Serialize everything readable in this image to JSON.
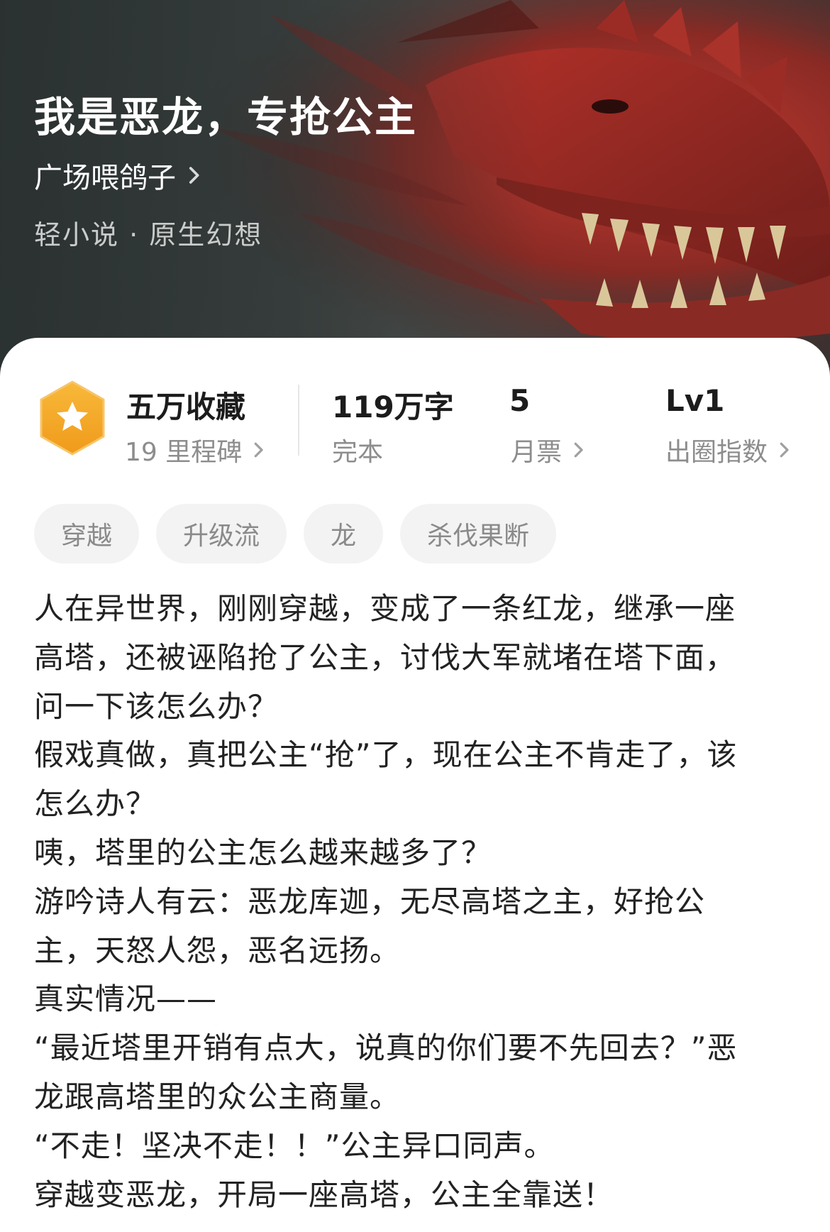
{
  "book": {
    "title": "我是恶龙，专抢公主",
    "author": "广场喂鸽子",
    "genre": "轻小说 · 原生幻想"
  },
  "stats": {
    "favorites": "五万收藏",
    "milestones": "19 里程碑",
    "word_count": "119万字",
    "status": "完本",
    "monthly_votes": "5",
    "monthly_votes_label": "月票",
    "level": "Lv1",
    "level_label": "出圈指数"
  },
  "tags": [
    "穿越",
    "升级流",
    "龙",
    "杀伐果断"
  ],
  "synopsis": [
    "人在异世界，刚刚穿越，变成了一条红龙，继承一座",
    "高塔，还被诬陷抢了公主，讨伐大军就堵在塔下面，",
    "问一下该怎么办？",
    "假戏真做，真把公主“抢”了，现在公主不肯走了，该",
    "怎么办？",
    "咦，塔里的公主怎么越来越多了？",
    "游吟诗人有云：恶龙库迦，无尽高塔之主，好抢公",
    "主，天怒人怨，恶名远扬。",
    "真实情况——",
    "“最近塔里开销有点大，说真的你们要不先回去？”恶",
    "龙跟高塔里的众公主商量。",
    "“不走！坚决不走！！”公主异口同声。",
    "穿越变恶龙，开局一座高塔，公主全靠送！"
  ],
  "icons": {
    "author_chevron": "chevron-right-icon",
    "badge": "star-hexagon-badge-icon",
    "stat_chevron": "chevron-right-icon"
  },
  "colors": {
    "badge_orange": "#f5a623",
    "dragon_red": "#b3312a",
    "muted_text": "#8d8d8d",
    "tag_bg": "#f3f3f3"
  }
}
